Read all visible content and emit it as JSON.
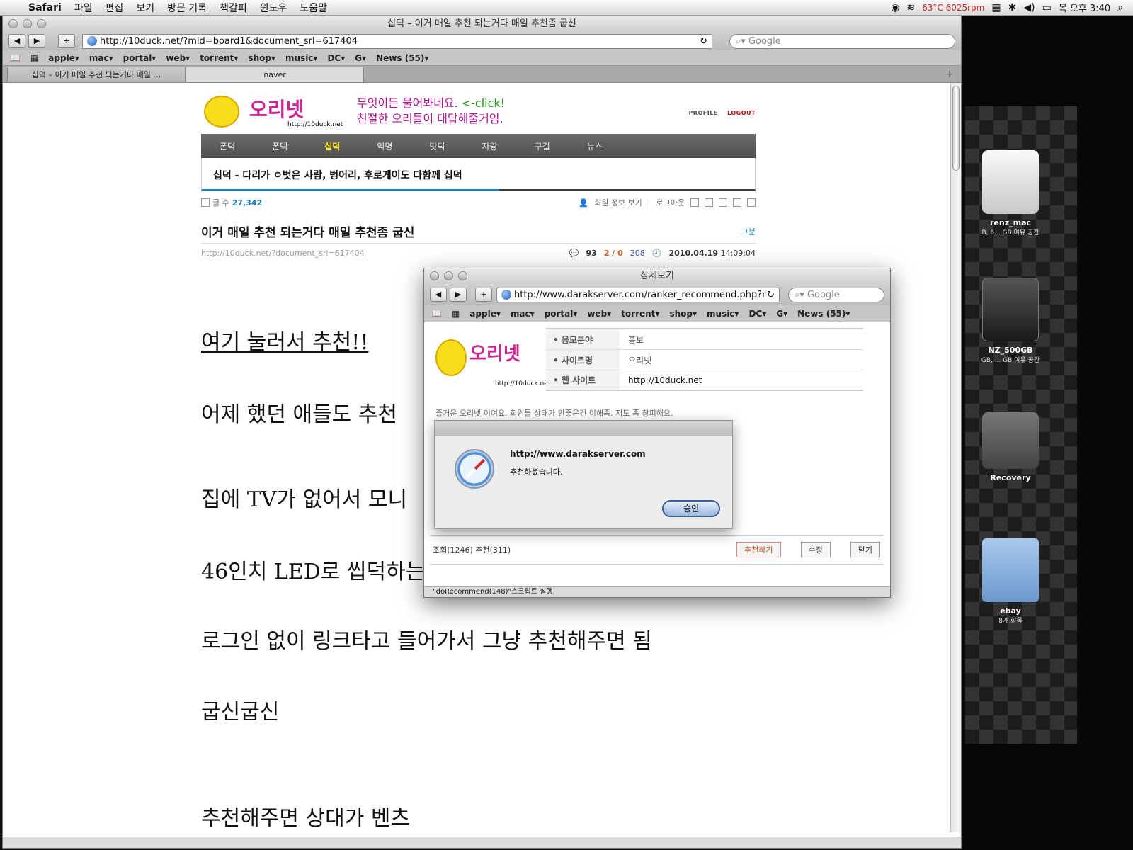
{
  "menubar": {
    "app": "Safari",
    "menus": [
      "파일",
      "편집",
      "보기",
      "방문 기록",
      "책갈피",
      "윈도우",
      "도움말"
    ],
    "temp": "63°C 6025rpm",
    "clock": "목 오후 3:40"
  },
  "main_window": {
    "title": "십덕 – 이거 매일 추천 되는거다 매일 추천좀 굽신",
    "url": "http://10duck.net/?mid=board1&document_srl=617404",
    "search_placeholder": "Google",
    "bookmarks": [
      "apple▾",
      "mac▾",
      "portal▾",
      "web▾",
      "torrent▾",
      "shop▾",
      "music▾",
      "DC▾",
      "G▾",
      "News (55)▾"
    ],
    "tabs": [
      "십덕 – 이거 매일 추천 되는거다 매일 …",
      "naver"
    ]
  },
  "site": {
    "logo_name": "오리넷",
    "logo_url": "http://10duck.net",
    "tagline_1": "무엇이든 물어봐네요.",
    "tagline_click": "<-click!",
    "tagline_2": "친절한 오리들이 대답해줄거임.",
    "top_profile": "PROFILE",
    "top_logout": "LOGOUT",
    "nav": [
      "폰덕",
      "폰텍",
      "십덕",
      "익명",
      "맛덕",
      "자랑",
      "구걸",
      "뉴스"
    ],
    "board_title": "십덕 - 다리가 ㅇ벗은 사람, 벙어리, 후로게이도 다함께 십덕",
    "count_label": "글 수",
    "count_value": "27,342",
    "member_info": "회원 정보 보기",
    "logout_link": "로그아웃",
    "doc_title": "이거 매일 추천 되는거다 매일 추천좀 굽신",
    "author": "그분",
    "doc_url": "http://10duck.net/?document_srl=617404",
    "comments": "93",
    "votes": "2 / 0",
    "readed": "208",
    "date": "2010.04.19",
    "time": "14:09:04",
    "body": [
      "여기 눌러서 추천!!",
      "어제 했던 애들도 추천",
      "집에 TV가 없어서 모니",
      "46인치 LED로 씹덕하는",
      "로그인 없이 링크타고 들어가서 그냥 추천해주면 됨",
      "굽신굽신",
      "추천해주면 상대가 벤츠"
    ]
  },
  "popup": {
    "title": "상세보기",
    "url": "http://www.darakserver.com/ranker_recommend.php?r",
    "search_placeholder": "Google",
    "bookmarks": [
      "apple▾",
      "mac▾",
      "portal▾",
      "web▾",
      "torrent▾",
      "shop▾",
      "music▾",
      "DC▾",
      "G▾",
      "News (55)▾"
    ],
    "logo_name": "오리넷",
    "logo_url": "http://10duck.net",
    "info": [
      {
        "k": "• 응모분야",
        "v": "홍보"
      },
      {
        "k": "• 사이트명",
        "v": "오리넷"
      },
      {
        "k": "• 웹 사이트",
        "v": "http://10duck.net"
      }
    ],
    "desc": "즐거운 오리넷 이여요. 회원들 상태가 안좋은건 이해좀. 저도 좀 창피해요.",
    "stats": "조회(1246) 추천(311)",
    "btn_recommend": "추천하기",
    "btn_edit": "수정",
    "btn_close": "닫기",
    "status": "\"doRecommend(148)\"스크립트 실행"
  },
  "alert": {
    "title": "http://www.darakserver.com",
    "message": "추천하셨습니다.",
    "ok": "승인"
  },
  "desktop": {
    "items": [
      {
        "name": "renz_mac",
        "sub": "B, 6... GB 여유 공간"
      },
      {
        "name": "NZ_500GB",
        "sub": "GB, ... GB 여유 공간"
      },
      {
        "name": "Recovery",
        "sub": ""
      },
      {
        "name": "ebay",
        "sub": "8개 항목"
      }
    ]
  }
}
